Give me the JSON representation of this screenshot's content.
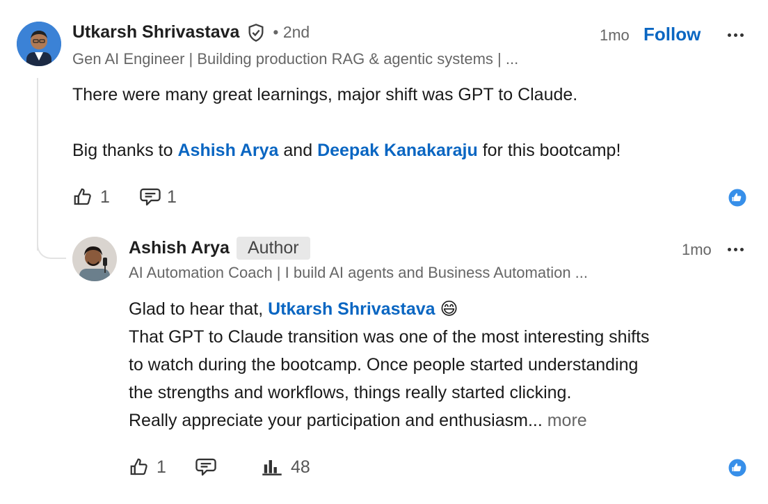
{
  "comment": {
    "author": "Utkarsh Shrivastava",
    "degree": "• 2nd",
    "headline": "Gen AI Engineer | Building production RAG & agentic systems | ...",
    "time": "1mo",
    "follow_label": "Follow",
    "line1": "There were many great learnings, major shift was GPT to Claude.",
    "thanks_prefix": "Big thanks to ",
    "mention1": "Ashish Arya",
    "thanks_and": " and ",
    "mention2": "Deepak Kanakaraju",
    "thanks_suffix": " for this bootcamp!",
    "like_count": "1",
    "reply_count": "1"
  },
  "reply": {
    "author": "Ashish Arya",
    "author_badge": "Author",
    "headline": "AI Automation Coach | I build AI agents and Business Automation ...",
    "time": "1mo",
    "greeting_prefix": "Glad to hear that, ",
    "greeting_mention": "Utkarsh Shrivastava",
    "emoji": "😄",
    "line2": "That GPT to Claude transition was one of the most interesting shifts",
    "line3": "to watch during the bootcamp. Once people started understanding",
    "line4": "the strengths and workflows, things really started clicking.",
    "line5": "Really appreciate your participation and enthusiasm...",
    "more_label": "more",
    "like_count": "1",
    "impressions_count": "48"
  },
  "icons": {
    "verified": "shield-check-icon",
    "like": "thumbs-up-outline-icon",
    "comment": "speech-bubble-icon",
    "analytics": "bar-chart-icon",
    "reaction": "like-reaction-icon",
    "overflow": "more-dots-icon"
  },
  "colors": {
    "link": "#0a66c2",
    "reaction_badge": "#378fe9"
  }
}
